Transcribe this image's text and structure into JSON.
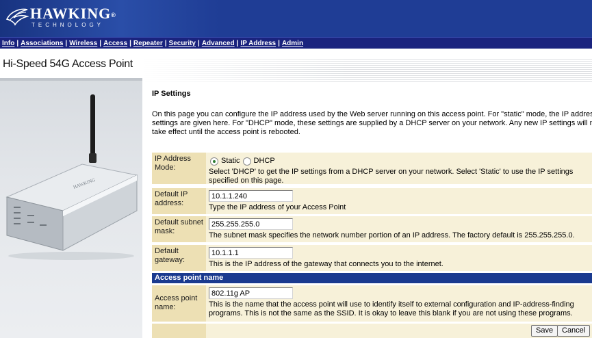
{
  "header": {
    "brand": "HAWKING",
    "brand_mark": "®",
    "brand_sub": "TECHNOLOGY"
  },
  "nav": {
    "items": [
      "Info",
      "Associations",
      "Wireless",
      "Access",
      "Repeater",
      "Security",
      "Advanced",
      "IP Address",
      "Admin"
    ]
  },
  "product_title": "Hi-Speed 54G Access Point",
  "page": {
    "title": "IP Settings",
    "intro_lines": [
      "On this page you can configure the IP address used by the Web server running on this access point. For \"static\" mode, the IP address",
      "settings are given here. For \"DHCP\" mode, these settings are supplied by a DHCP server on your network. Any new IP settings will not",
      "take effect until the access point is rebooted."
    ]
  },
  "form": {
    "ip_mode": {
      "label_line1": "IP Address",
      "label_line2": "Mode:",
      "options": [
        "Static",
        "DHCP"
      ],
      "selected": "Static",
      "desc_line1": "Select 'DHCP' to get the IP settings from a DHCP server on your network. Select 'Static' to use the IP settings",
      "desc_line2": "specified on this page."
    },
    "ip_address": {
      "label_line1": "Default IP",
      "label_line2": "address:",
      "value": "10.1.1.240",
      "desc": "Type the IP address of your Access Point"
    },
    "subnet_mask": {
      "label_line1": "Default subnet",
      "label_line2": "mask:",
      "value": "255.255.255.0",
      "desc": "The subnet mask specifies the network number portion of an IP address. The factory default is 255.255.255.0."
    },
    "gateway": {
      "label_line1": "Default",
      "label_line2": "gateway:",
      "value": "10.1.1.1",
      "desc": "This is the IP address of the gateway that connects you to the internet."
    },
    "ap_name_section": "Access point name",
    "ap_name": {
      "label_line1": "Access point",
      "label_line2": "name:",
      "value": "802.11g AP",
      "desc_line1": "This is the name that the access point will use to identify itself to external configuration and IP-address-finding",
      "desc_line2": "programs. This is not the same as the SSID. It is okay to leave this blank if you are not using these programs."
    },
    "buttons": {
      "save": "Save",
      "cancel": "Cancel"
    }
  },
  "colors": {
    "banner": "#1f3d95",
    "navbar": "#1a237e",
    "label_bg": "#ede0b4",
    "row_bg": "#f7f1d9",
    "section_header": "#1a3a8f"
  }
}
